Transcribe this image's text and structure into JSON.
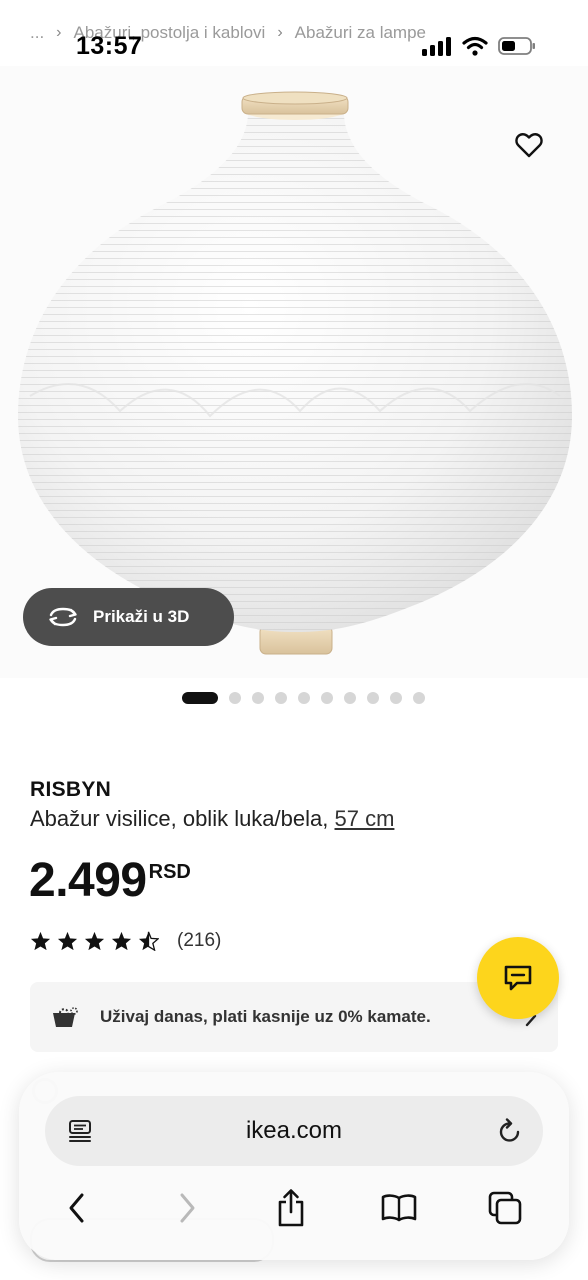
{
  "breadcrumb": {
    "items": [
      "...",
      "Abažuri, postolja i kablovi",
      "Abažuri za lampe"
    ]
  },
  "status": {
    "time": "13:57"
  },
  "gallery": {
    "view3d_label": "Prikaži u 3D",
    "slide_count": 10,
    "active_slide": 1
  },
  "product": {
    "name": "RISBYN",
    "description": "Abažur visilice, oblik luka/bela,",
    "size_link": "57 cm",
    "price": "2.499",
    "currency": "RSD",
    "rating": 4.5,
    "rating_count": "(216)"
  },
  "promo": {
    "text": "Uživaj danas, plati kasnije uz 0% kamate."
  },
  "safari": {
    "url": "ikea.com"
  },
  "colors": {
    "brand_yellow": "#fdd51c",
    "dark_button": "#4d4d4d",
    "dot_active": "#111111",
    "dot_inactive": "#d6d6d6"
  },
  "icons": {
    "favorite": "heart-icon",
    "view3d": "rotate-3d-icon",
    "chat": "chat-icon",
    "promo": "bag-cart-icon",
    "reader": "reader-mode-icon",
    "reload": "reload-icon",
    "back": "chevron-left-icon",
    "forward": "chevron-right-icon",
    "share": "share-icon",
    "bookmarks": "book-icon",
    "tabs": "tabs-icon"
  }
}
